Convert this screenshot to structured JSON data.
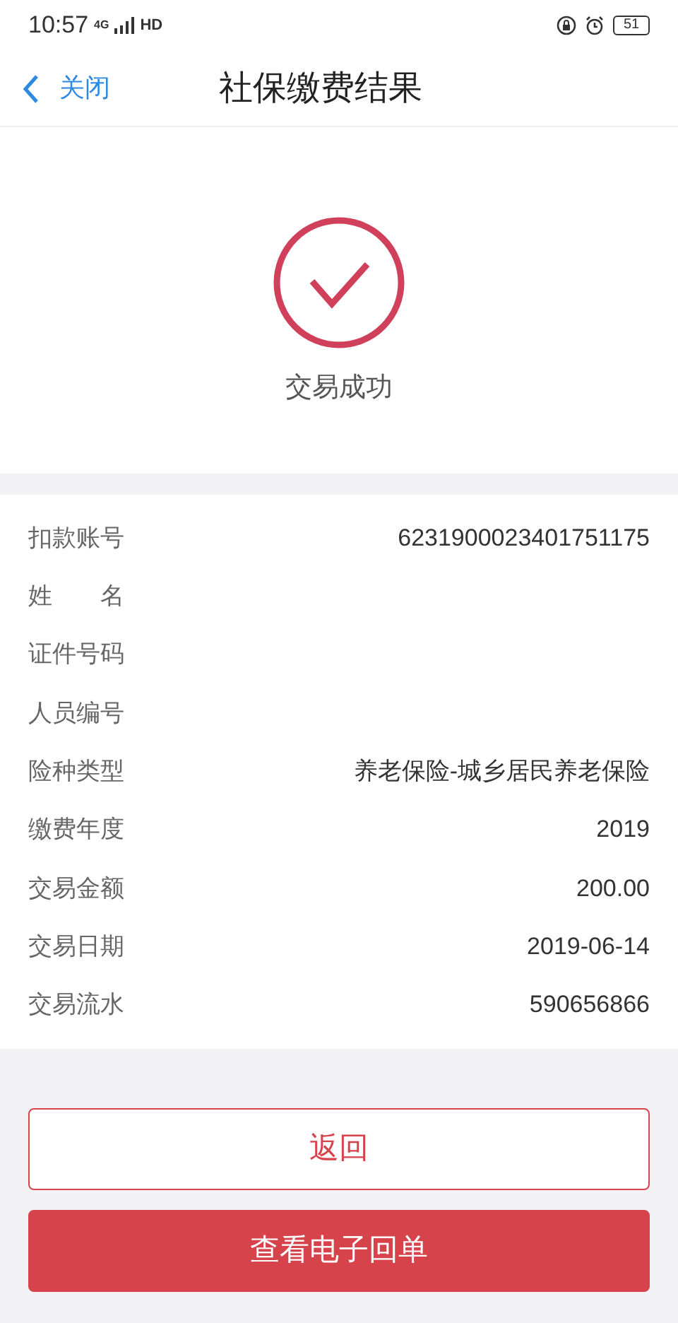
{
  "status_bar": {
    "time": "10:57",
    "network": "4G",
    "hd": "HD",
    "battery": "51"
  },
  "nav": {
    "back": "关闭",
    "title": "社保缴费结果"
  },
  "result": {
    "message": "交易成功"
  },
  "details": [
    {
      "label": "扣款账号",
      "value": "6231900023401751175"
    },
    {
      "label": "姓　　名"
    },
    {
      "label": "证件号码"
    },
    {
      "label": "人员编号"
    },
    {
      "label": "险种类型",
      "value": "养老保险-城乡居民养老保险"
    },
    {
      "label": "缴费年度",
      "value": "2019"
    },
    {
      "label": "交易金额",
      "value": "200.00"
    },
    {
      "label": "交易日期",
      "value": "2019-06-14"
    },
    {
      "label": "交易流水",
      "value": "590656866"
    }
  ],
  "buttons": [
    {
      "label": "返回",
      "kind": "outline"
    },
    {
      "label": "查看电子回单",
      "kind": "primary"
    }
  ]
}
